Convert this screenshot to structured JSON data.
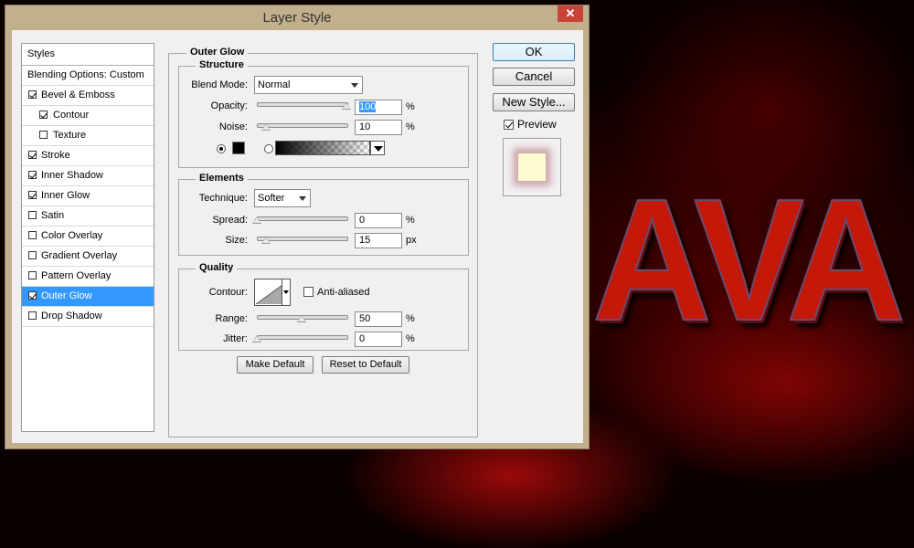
{
  "window": {
    "title": "Layer Style",
    "close_glyph": "✕"
  },
  "styles_panel": {
    "header": "Styles",
    "blending": "Blending Options: Custom",
    "items": [
      {
        "label": "Bevel & Emboss",
        "checked": true,
        "indent": false,
        "selected": false
      },
      {
        "label": "Contour",
        "checked": true,
        "indent": true,
        "selected": false
      },
      {
        "label": "Texture",
        "checked": false,
        "indent": true,
        "selected": false
      },
      {
        "label": "Stroke",
        "checked": true,
        "indent": false,
        "selected": false
      },
      {
        "label": "Inner Shadow",
        "checked": true,
        "indent": false,
        "selected": false
      },
      {
        "label": "Inner Glow",
        "checked": true,
        "indent": false,
        "selected": false
      },
      {
        "label": "Satin",
        "checked": false,
        "indent": false,
        "selected": false
      },
      {
        "label": "Color Overlay",
        "checked": false,
        "indent": false,
        "selected": false
      },
      {
        "label": "Gradient Overlay",
        "checked": false,
        "indent": false,
        "selected": false
      },
      {
        "label": "Pattern Overlay",
        "checked": false,
        "indent": false,
        "selected": false
      },
      {
        "label": "Outer Glow",
        "checked": true,
        "indent": false,
        "selected": true
      },
      {
        "label": "Drop Shadow",
        "checked": false,
        "indent": false,
        "selected": false
      }
    ]
  },
  "outer_glow": {
    "title": "Outer Glow",
    "structure": {
      "title": "Structure",
      "blend_mode_label": "Blend Mode:",
      "blend_mode_value": "Normal",
      "opacity_label": "Opacity:",
      "opacity_value": "100",
      "opacity_unit": "%",
      "opacity_fraction": 1.0,
      "noise_label": "Noise:",
      "noise_value": "10",
      "noise_unit": "%",
      "noise_fraction": 0.1,
      "color_swatch": "#000000",
      "color_radio_selected": "color"
    },
    "elements": {
      "title": "Elements",
      "technique_label": "Technique:",
      "technique_value": "Softer",
      "spread_label": "Spread:",
      "spread_value": "0",
      "spread_unit": "%",
      "spread_fraction": 0.0,
      "size_label": "Size:",
      "size_value": "15",
      "size_unit": "px",
      "size_fraction": 0.1
    },
    "quality": {
      "title": "Quality",
      "contour_label": "Contour:",
      "anti_aliased_label": "Anti-aliased",
      "anti_aliased_checked": false,
      "range_label": "Range:",
      "range_value": "50",
      "range_unit": "%",
      "range_fraction": 0.5,
      "jitter_label": "Jitter:",
      "jitter_value": "0",
      "jitter_unit": "%",
      "jitter_fraction": 0.0
    },
    "make_default": "Make Default",
    "reset_default": "Reset to Default"
  },
  "right_panel": {
    "ok": "OK",
    "cancel": "Cancel",
    "new_style": "New Style...",
    "preview_label": "Preview",
    "preview_checked": true
  },
  "canvas": {
    "text": "AVA"
  }
}
